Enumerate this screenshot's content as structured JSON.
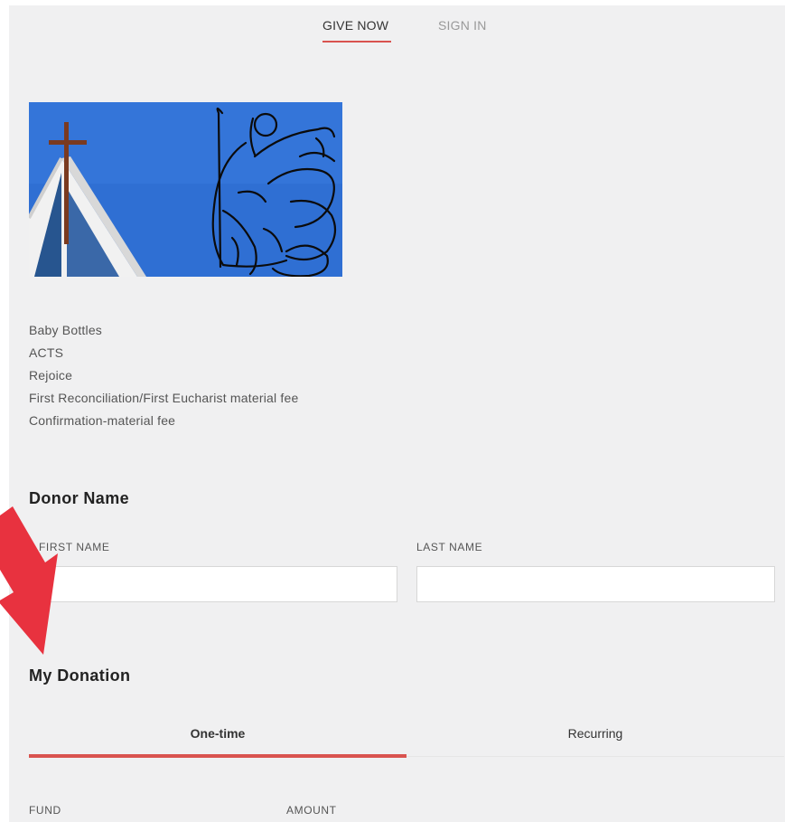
{
  "nav": {
    "give_now": "GIVE NOW",
    "sign_in": "SIGN IN"
  },
  "funds": [
    "Baby Bottles",
    "ACTS",
    "Rejoice",
    "First Reconciliation/First Eucharist material fee",
    "Confirmation-material fee"
  ],
  "donor": {
    "title": "Donor Name",
    "first_name_label": "FIRST NAME",
    "last_name_label": "LAST NAME",
    "first_name_value": "",
    "last_name_value": ""
  },
  "donation": {
    "title": "My Donation",
    "tab_one_time": "One-time",
    "tab_recurring": "Recurring",
    "fund_label": "FUND",
    "amount_label": "AMOUNT"
  },
  "colors": {
    "accent": "#d9534f",
    "arrow": "#e8323f",
    "sky": "#2f6fd3"
  },
  "icons": {
    "annotation": "red-arrow-icon"
  }
}
